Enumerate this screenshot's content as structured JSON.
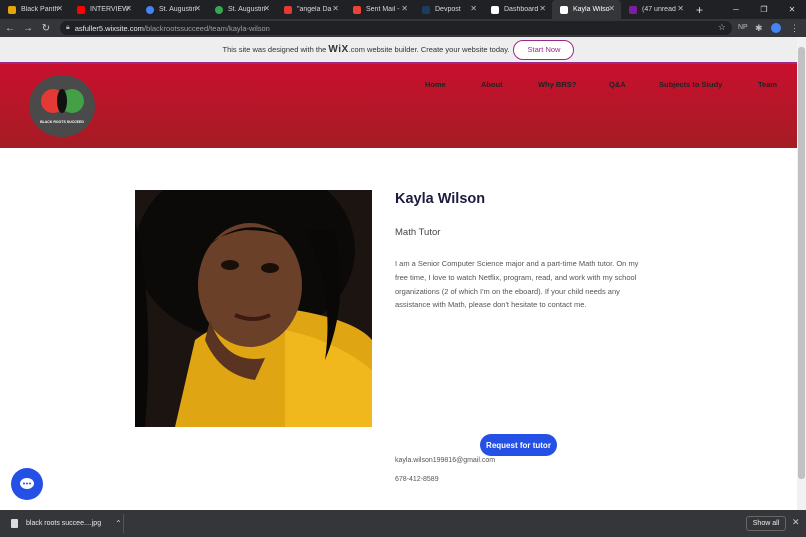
{
  "browser": {
    "tabs": [
      {
        "label": "Black Panth",
        "color": "#e5a50a"
      },
      {
        "label": "INTERVIEW",
        "color": "#ff0000"
      },
      {
        "label": "St. Augustin",
        "color": "#4285f4"
      },
      {
        "label": "St. Augustin",
        "color": "#34a853"
      },
      {
        "label": "\"angela Da",
        "color": "#e53935"
      },
      {
        "label": "Sent Mail -",
        "color": "#ea4335"
      },
      {
        "label": "Devpost",
        "color": "#1f3a5a"
      },
      {
        "label": "Dashboard",
        "color": "#ffffff"
      },
      {
        "label": "Kayla Wilso",
        "color": "#ffffff"
      },
      {
        "label": "(47 unread",
        "color": "#7b1fa2"
      }
    ],
    "url_host": "asfuller5.wixsite.com",
    "url_path": "/blackrootssucceed/team/kayla-wilson",
    "ext_np": "NP"
  },
  "wix_banner": {
    "text_before": "This site was designed with the ",
    "brand": "WiX",
    "text_after": ".com website builder. Create your website today.",
    "cta": "Start Now"
  },
  "site": {
    "logo_text": "BLACK ROOTS SUCCEED",
    "nav": [
      "Home",
      "About",
      "Why BRS?",
      "Q&A",
      "Subjects to Study",
      "Team"
    ]
  },
  "profile": {
    "name": "Kayla Wilson",
    "role": "Math Tutor",
    "bio": "I am a Senior Computer Science major and a part-time Math tutor. On my free time, I love to watch Netflix, program, read, and work with my school organizations (2 of which I'm on the eboard). If your child needs any assistance with Math, please don't hesitate to contact me.",
    "request_button": "Request for tutor",
    "email": "kayla.wilson199816@gmail.com",
    "phone": "678-412-8589"
  },
  "downloads": {
    "file": "black roots succee....jpg",
    "show_all": "Show all"
  }
}
